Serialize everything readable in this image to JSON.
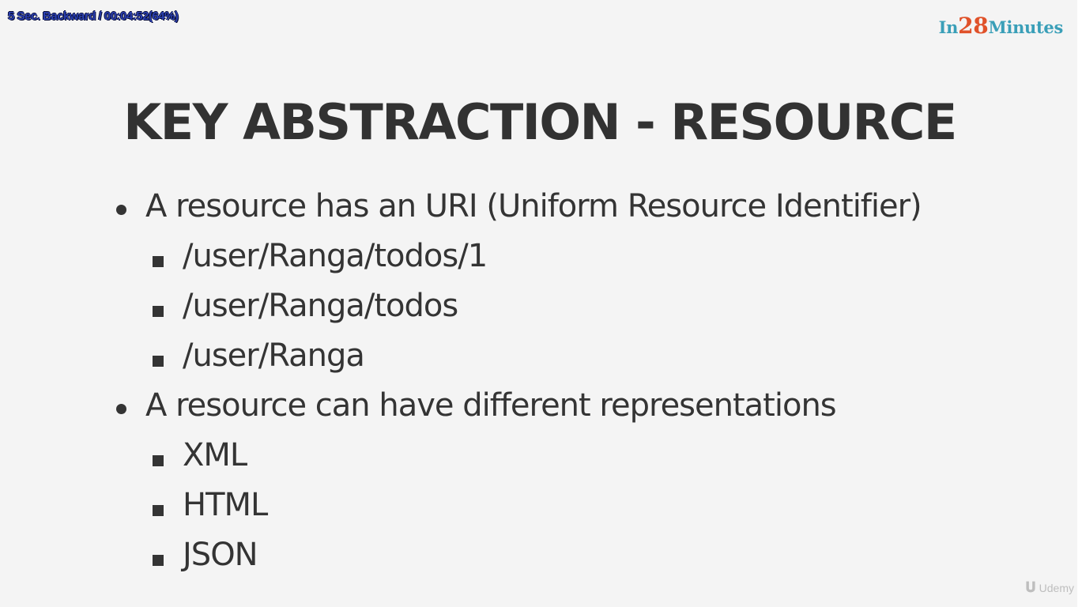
{
  "player": {
    "status_text": "5 Sec. Backward / 00:04:52(64%)"
  },
  "brand": {
    "logo_part1": "In",
    "logo_part2": "28",
    "logo_part3": "Minutes"
  },
  "slide": {
    "title": "KEY ABSTRACTION - RESOURCE",
    "bullets": [
      {
        "text": "A resource has an URI (Uniform Resource Identifier)",
        "sub_items": [
          "/user/Ranga/todos/1",
          "/user/Ranga/todos",
          "/user/Ranga"
        ]
      },
      {
        "text": "A resource can have different representations",
        "sub_items": [
          "XML",
          "HTML",
          "JSON"
        ]
      }
    ]
  },
  "watermark": {
    "icon": "udemy-logo-icon",
    "text": "Udemy"
  },
  "colors": {
    "background": "#f4f4f4",
    "text": "#343434",
    "logo_teal": "#3a9fb8",
    "logo_orange": "#e0522a",
    "player_status": "#2a3fb0"
  }
}
